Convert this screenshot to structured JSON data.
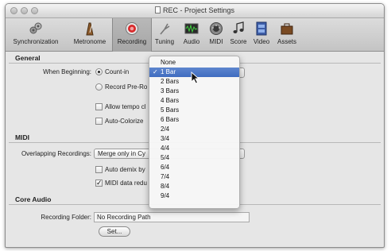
{
  "window": {
    "title": "REC - Project Settings"
  },
  "toolbar": {
    "items": [
      {
        "label": "Synchronization",
        "icon": "synchronization-icon"
      },
      {
        "label": "Metronome",
        "icon": "metronome-icon"
      },
      {
        "label": "Recording",
        "icon": "record-icon",
        "selected": true
      },
      {
        "label": "Tuning",
        "icon": "tuning-fork-icon"
      },
      {
        "label": "Audio",
        "icon": "audio-icon"
      },
      {
        "label": "MIDI",
        "icon": "midi-icon"
      },
      {
        "label": "Score",
        "icon": "score-icon"
      },
      {
        "label": "Video",
        "icon": "video-icon"
      },
      {
        "label": "Assets",
        "icon": "assets-icon"
      }
    ]
  },
  "general": {
    "heading": "General",
    "when_beginning_label": "When Beginning:",
    "count_in_label": "Count-in",
    "record_preroll_label": "Record Pre-Ro",
    "allow_tempo_label": "Allow tempo cl",
    "auto_colorize_label": "Auto-Colorize"
  },
  "midi": {
    "heading": "MIDI",
    "overlapping_label": "Overlapping Recordings:",
    "overlapping_value": "Merge only in Cy",
    "auto_demix_label": "Auto demix by",
    "midi_data_label": "MIDI data redu"
  },
  "core_audio": {
    "heading": "Core Audio",
    "recording_folder_label": "Recording Folder:",
    "recording_folder_value": "No Recording Path",
    "set_button": "Set..."
  },
  "menu": {
    "items": [
      "None",
      "1 Bar",
      "2 Bars",
      "3 Bars",
      "4 Bars",
      "5 Bars",
      "6 Bars",
      "2/4",
      "3/4",
      "4/4",
      "5/4",
      "6/4",
      "7/4",
      "8/4",
      "9/4"
    ],
    "selected_index": 1,
    "check_mark": "✓"
  },
  "colors": {
    "highlight": "#3f6cc0",
    "record_red": "#d8282a"
  }
}
